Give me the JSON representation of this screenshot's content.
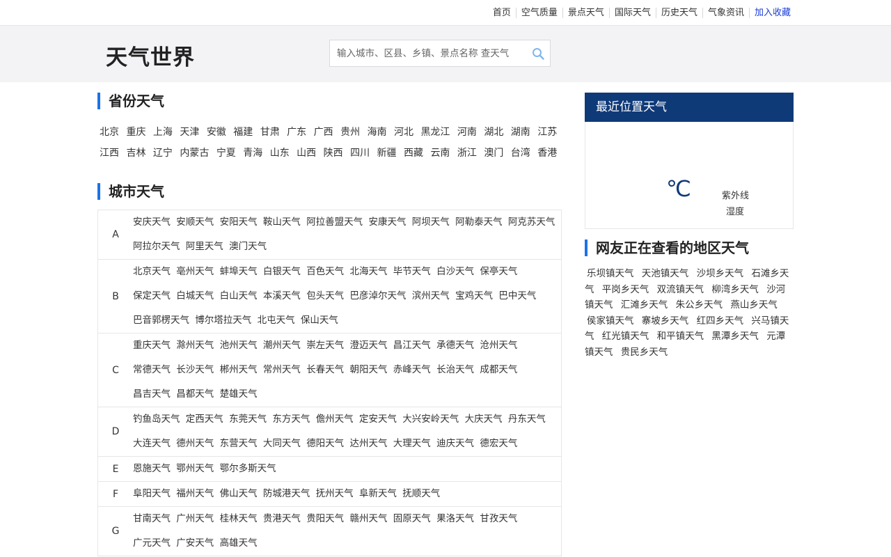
{
  "topnav": {
    "links": [
      "首页",
      "空气质量",
      "景点天气",
      "国际天气",
      "历史天气",
      "气象资讯"
    ],
    "favorite": "加入收藏"
  },
  "header": {
    "logo": "天气世界",
    "search_placeholder": "输入城市、区县、乡镇、景点名称 查天气"
  },
  "provinces": {
    "title": "省份天气",
    "items": [
      "北京",
      "重庆",
      "上海",
      "天津",
      "安徽",
      "福建",
      "甘肃",
      "广东",
      "广西",
      "贵州",
      "海南",
      "河北",
      "黑龙江",
      "河南",
      "湖北",
      "湖南",
      "江苏",
      "江西",
      "吉林",
      "辽宁",
      "内蒙古",
      "宁夏",
      "青海",
      "山东",
      "山西",
      "陕西",
      "四川",
      "新疆",
      "西藏",
      "云南",
      "浙江",
      "澳门",
      "台湾",
      "香港"
    ]
  },
  "cities": {
    "title": "城市天气",
    "groups": [
      {
        "letter": "A",
        "cities": [
          "安庆天气",
          "安顺天气",
          "安阳天气",
          "鞍山天气",
          "阿拉善盟天气",
          "安康天气",
          "阿坝天气",
          "阿勒泰天气",
          "阿克苏天气",
          "阿拉尔天气",
          "阿里天气",
          "澳门天气"
        ]
      },
      {
        "letter": "B",
        "cities": [
          "北京天气",
          "亳州天气",
          "蚌埠天气",
          "白银天气",
          "百色天气",
          "北海天气",
          "毕节天气",
          "白沙天气",
          "保亭天气",
          "保定天气",
          "白城天气",
          "白山天气",
          "本溪天气",
          "包头天气",
          "巴彦淖尔天气",
          "滨州天气",
          "宝鸡天气",
          "巴中天气",
          "巴音郭楞天气",
          "博尔塔拉天气",
          "北屯天气",
          "保山天气"
        ]
      },
      {
        "letter": "C",
        "cities": [
          "重庆天气",
          "滁州天气",
          "池州天气",
          "潮州天气",
          "崇左天气",
          "澄迈天气",
          "昌江天气",
          "承德天气",
          "沧州天气",
          "常德天气",
          "长沙天气",
          "郴州天气",
          "常州天气",
          "长春天气",
          "朝阳天气",
          "赤峰天气",
          "长治天气",
          "成都天气",
          "昌吉天气",
          "昌都天气",
          "楚雄天气"
        ]
      },
      {
        "letter": "D",
        "cities": [
          "钓鱼岛天气",
          "定西天气",
          "东莞天气",
          "东方天气",
          "儋州天气",
          "定安天气",
          "大兴安岭天气",
          "大庆天气",
          "丹东天气",
          "大连天气",
          "德州天气",
          "东营天气",
          "大同天气",
          "德阳天气",
          "达州天气",
          "大理天气",
          "迪庆天气",
          "德宏天气"
        ]
      },
      {
        "letter": "E",
        "cities": [
          "恩施天气",
          "鄂州天气",
          "鄂尔多斯天气"
        ]
      },
      {
        "letter": "F",
        "cities": [
          "阜阳天气",
          "福州天气",
          "佛山天气",
          "防城港天气",
          "抚州天气",
          "阜新天气",
          "抚顺天气"
        ]
      },
      {
        "letter": "G",
        "cities": [
          "甘南天气",
          "广州天气",
          "桂林天气",
          "贵港天气",
          "贵阳天气",
          "赣州天气",
          "固原天气",
          "果洛天气",
          "甘孜天气",
          "广元天气",
          "广安天气",
          "高雄天气"
        ]
      }
    ]
  },
  "location": {
    "title": "最近位置天气",
    "unit": "℃",
    "uv_label": "紫外线",
    "humidity_label": "湿度"
  },
  "hot": {
    "title": "网友正在查看的地区天气",
    "items": [
      "乐坝镇天气",
      "天池镇天气",
      "沙坝乡天气",
      "石滩乡天气",
      "平岗乡天气",
      "双流镇天气",
      "柳湾乡天气",
      "沙河镇天气",
      "汇滩乡天气",
      "朱公乡天气",
      "燕山乡天气",
      "侯家镇天气",
      "寨坡乡天气",
      "红四乡天气",
      "兴马镇天气",
      "红光镇天气",
      "和平镇天气",
      "黑潭乡天气",
      "元潭镇天气",
      "贵民乡天气"
    ]
  },
  "colors": {
    "accent": "#1a73e8",
    "location_header": "#0f3a78",
    "favorite_link": "#1a3cd6"
  }
}
